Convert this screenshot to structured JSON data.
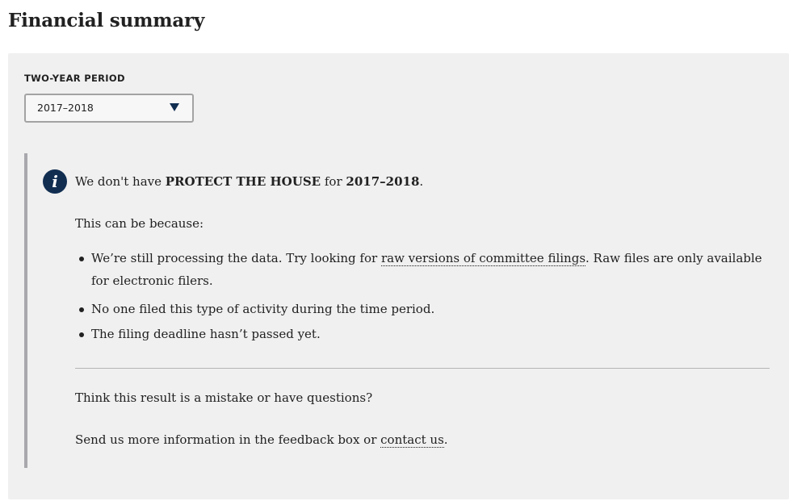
{
  "page": {
    "title": "Financial summary"
  },
  "filter": {
    "period_label": "TWO-YEAR PERIOD",
    "selected_period": "2017–2018"
  },
  "notice": {
    "intro_prefix": "We don't have ",
    "committee_name": "PROTECT THE HOUSE",
    "intro_middle": " for ",
    "period": "2017–2018",
    "intro_suffix": ".",
    "because": "This can be because:",
    "reason1_prefix": "We’re still processing the data. Try looking for ",
    "reason1_link": "raw versions of committee filings",
    "reason1_suffix": ". Raw files are only available for electronic filers.",
    "reason2": "No one filed this type of activity during the time period.",
    "reason3": "The filing deadline hasn’t passed yet.",
    "mistake_question": "Think this result is a mistake or have questions?",
    "contact_prefix": "Send us more information in the feedback box or ",
    "contact_link": "contact us",
    "contact_suffix": "."
  },
  "colors": {
    "accent_navy": "#112e51",
    "panel_bg": "#f0f0f0",
    "border_gray": "#a8a8ad"
  },
  "icons": {
    "notice_icon": "info-icon",
    "select_icon": "chevron-down-icon"
  }
}
